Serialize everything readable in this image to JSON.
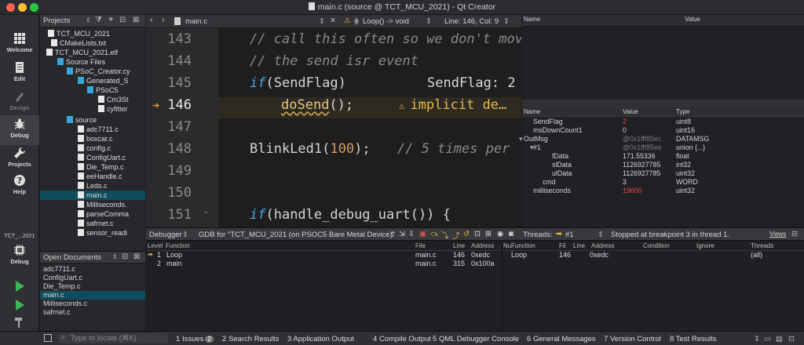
{
  "window": {
    "title": "main.c (source @ TCT_MCU_2021) - Qt Creator",
    "file_icon": "file-icon"
  },
  "modes": [
    {
      "label": "Welcome",
      "icon": "grid-icon"
    },
    {
      "label": "Edit",
      "icon": "document-icon"
    },
    {
      "label": "Design",
      "icon": "pen-icon"
    },
    {
      "label": "Debug",
      "icon": "bug-icon"
    },
    {
      "label": "Projects",
      "icon": "wrench-icon"
    },
    {
      "label": "Help",
      "icon": "help-icon"
    }
  ],
  "kit": {
    "project": "TCT_...2021",
    "mode": "Debug"
  },
  "projects": {
    "title": "Projects",
    "tree": [
      {
        "label": "TCT_MCU_2021",
        "indent": 0
      },
      {
        "label": "CMakeLists.txt",
        "indent": 1
      },
      {
        "label": "TCT_MCU_2021.elf",
        "indent": 1
      },
      {
        "label": "Source Files",
        "indent": 2
      },
      {
        "label": "PSoC_Creator.cy",
        "indent": 3
      },
      {
        "label": "Generated_S",
        "indent": 4
      },
      {
        "label": "PSoC5",
        "indent": 5
      },
      {
        "label": "Cm3St",
        "indent": 6
      },
      {
        "label": "cyfitter",
        "indent": 6
      },
      {
        "label": "source",
        "indent": 3
      },
      {
        "label": "adc7711.c",
        "indent": 4
      },
      {
        "label": "boxcar.c",
        "indent": 4
      },
      {
        "label": "config.c",
        "indent": 4
      },
      {
        "label": "ConfigUart.c",
        "indent": 4
      },
      {
        "label": "Die_Temp.c",
        "indent": 4
      },
      {
        "label": "eeHandle.c",
        "indent": 4
      },
      {
        "label": "Leds.c",
        "indent": 4
      },
      {
        "label": "main.c",
        "indent": 4
      },
      {
        "label": "Milliseconds.",
        "indent": 4
      },
      {
        "label": "parseComma",
        "indent": 4
      },
      {
        "label": "safrnet.c",
        "indent": 4
      },
      {
        "label": "sensor_readi",
        "indent": 4
      }
    ]
  },
  "open_documents": {
    "title": "Open Documents",
    "items": [
      "adc7711.c",
      "ConfigUart.c",
      "Die_Temp.c",
      "main.c",
      "Milliseconds.c",
      "safrnet.c"
    ]
  },
  "editor": {
    "file": "main.c",
    "symbol": "Loop() -> void",
    "position": "Line: 146, Col: 9",
    "lines": [
      {
        "n": "143",
        "text": "// call this often so we don't mov"
      },
      {
        "n": "144",
        "text": "// the send isr event"
      },
      {
        "n": "145",
        "kw": "if",
        "rest": "(SendFlag)",
        "tooltip": "SendFlag: 2"
      },
      {
        "n": "146",
        "call": "doSend",
        "rest": "();",
        "warning": "implicit de…"
      },
      {
        "n": "147",
        "text": ""
      },
      {
        "n": "148",
        "fn": "BlinkLed1(",
        "arg": "100",
        "tail": ");",
        "comment": "// 5 times per"
      },
      {
        "n": "149",
        "text": ""
      },
      {
        "n": "150",
        "text": ""
      },
      {
        "n": "151",
        "kw": "if",
        "rest": "(handle_debug_uart()) {"
      }
    ]
  },
  "expressions": {
    "col_name": "Name",
    "col_value": "Value"
  },
  "locals": {
    "col_name": "Name",
    "col_value": "Value",
    "col_type": "Type",
    "rows": [
      {
        "name": "SendFlag",
        "value": "2",
        "type": "uint8",
        "indent": 1,
        "changed": true
      },
      {
        "name": "msDownCount1",
        "value": "0",
        "type": "uint16",
        "indent": 1
      },
      {
        "name": "OutMsg",
        "value": "@0x1fff85ec",
        "type": "DATAMSG",
        "indent": 0,
        "dim": true
      },
      {
        "name": "#1",
        "value": "@0x1fff85ee",
        "type": "union {...}",
        "indent": 1,
        "dim": true
      },
      {
        "name": "fData",
        "value": "171.55336",
        "type": "float",
        "indent": 3
      },
      {
        "name": "slData",
        "value": "1126927785",
        "type": "int32",
        "indent": 3
      },
      {
        "name": "ulData",
        "value": "1126927785",
        "type": "uint32",
        "indent": 3
      },
      {
        "name": "cmd",
        "value": "3",
        "type": "WORD",
        "indent": 2
      },
      {
        "name": "milliseconds",
        "value": "19600",
        "type": "uint32",
        "indent": 1,
        "changed": true
      }
    ]
  },
  "debugger": {
    "label": "Debugger",
    "engine": "GDB for \"TCT_MCU_2021 (on PSOC5 Bare Metal Device)\"",
    "threads_label": "Threads:",
    "thread": "#1",
    "status": "Stopped at breakpoint 3 in thread 1.",
    "views": "Views"
  },
  "stack": {
    "headers": {
      "level": "Level",
      "function": "Function",
      "file": "File",
      "line": "Line",
      "address": "Address"
    },
    "rows": [
      {
        "level": "1",
        "function": "Loop",
        "file": "main.c",
        "line": "146",
        "address": "0xedc"
      },
      {
        "level": "2",
        "function": "main",
        "file": "main.c",
        "line": "315",
        "address": "0x100a"
      }
    ]
  },
  "breakpoints": {
    "headers": {
      "num": "Nu",
      "function": "Function",
      "file": "Fil",
      "line": "Line",
      "address": "Address",
      "condition": "Condition",
      "ignore": "Ignore",
      "threads": "Threads"
    },
    "rows": [
      {
        "function": "Loop",
        "line": "146",
        "address": "0xedc",
        "threads": "(all)"
      }
    ]
  },
  "statusbar": {
    "locate_placeholder": "Type to locate (⌘K)",
    "tabs": [
      {
        "n": "1",
        "label": "Issues",
        "badge": "2"
      },
      {
        "n": "2",
        "label": "Search Results"
      },
      {
        "n": "3",
        "label": "Application Output"
      },
      {
        "n": "4",
        "label": "Compile Output"
      },
      {
        "n": "5",
        "label": "QML Debugger Console"
      },
      {
        "n": "6",
        "label": "General Messages"
      },
      {
        "n": "7",
        "label": "Version Control"
      },
      {
        "n": "8",
        "label": "Test Results"
      }
    ]
  },
  "colors": {
    "accent": "#0f4c5c",
    "changed": "#e04c4c",
    "keyword": "#4fa3e0",
    "warning": "#e8b84a"
  }
}
